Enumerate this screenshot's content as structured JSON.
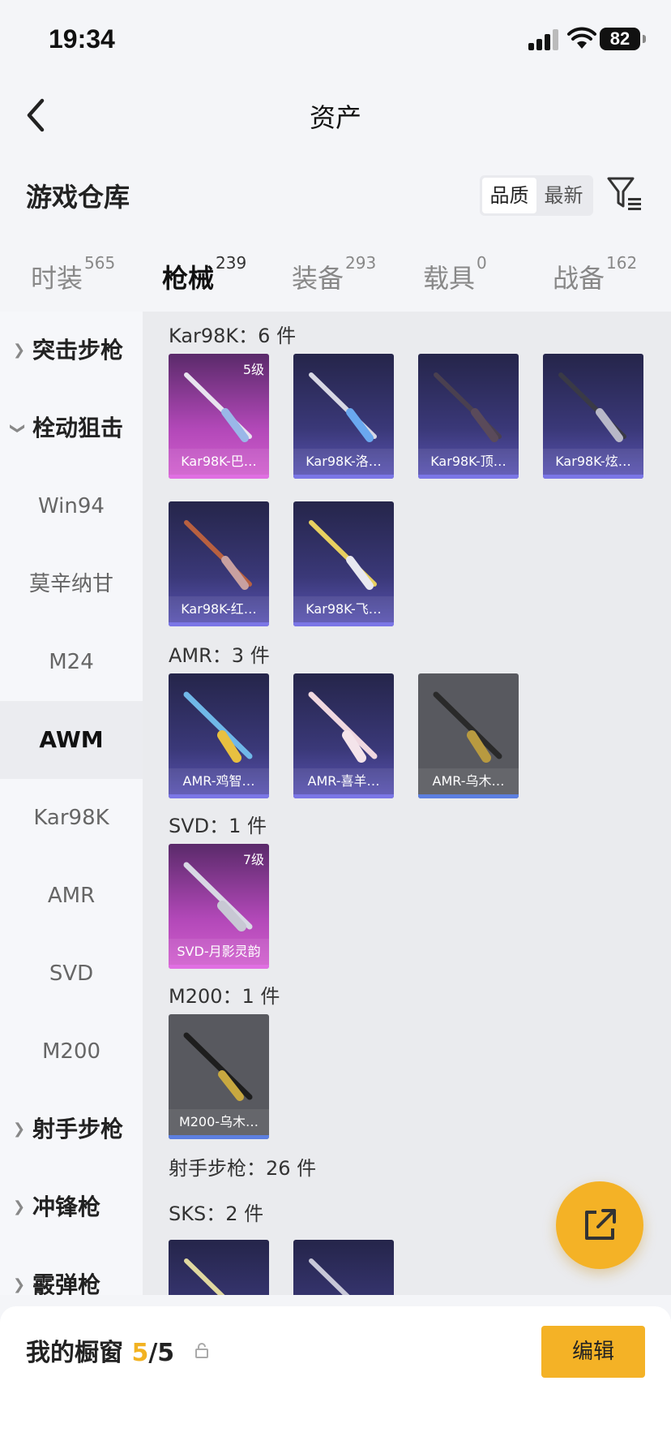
{
  "status": {
    "time": "19:34",
    "battery": "82"
  },
  "nav": {
    "title": "资产"
  },
  "header": {
    "title": "游戏仓库",
    "sort": [
      "品质",
      "最新"
    ]
  },
  "tabs": [
    {
      "label": "时装",
      "count": "565"
    },
    {
      "label": "枪械",
      "count": "239",
      "active": true
    },
    {
      "label": "装备",
      "count": "293"
    },
    {
      "label": "载具",
      "count": "0"
    },
    {
      "label": "战备",
      "count": "162"
    }
  ],
  "side": [
    {
      "label": "突击步枪",
      "type": "group",
      "expanded": false
    },
    {
      "label": "栓动狙击",
      "type": "group",
      "expanded": true
    },
    {
      "label": "Win94"
    },
    {
      "label": "莫辛纳甘"
    },
    {
      "label": "M24"
    },
    {
      "label": "AWM",
      "selected": true
    },
    {
      "label": "Kar98K"
    },
    {
      "label": "AMR"
    },
    {
      "label": "SVD"
    },
    {
      "label": "M200"
    },
    {
      "label": "射手步枪",
      "type": "group",
      "expanded": false
    },
    {
      "label": "冲锋枪",
      "type": "group",
      "expanded": false
    },
    {
      "label": "霰弹枪",
      "type": "group",
      "expanded": false
    }
  ],
  "sections": {
    "kar": {
      "label": "Kar98K：6 件",
      "items": [
        {
          "name": "Kar98K-巴…",
          "rarity": "pink",
          "level": "5级"
        },
        {
          "name": "Kar98K-洛…",
          "rarity": "purple"
        },
        {
          "name": "Kar98K-顶…",
          "rarity": "purple"
        },
        {
          "name": "Kar98K-炫…",
          "rarity": "purple"
        },
        {
          "name": "Kar98K-红…",
          "rarity": "purple"
        },
        {
          "name": "Kar98K-飞…",
          "rarity": "purple"
        }
      ]
    },
    "amr": {
      "label": "AMR：3 件",
      "items": [
        {
          "name": "AMR-鸡智…",
          "rarity": "purple"
        },
        {
          "name": "AMR-喜羊…",
          "rarity": "purple"
        },
        {
          "name": "AMR-乌木…",
          "rarity": "gray"
        }
      ]
    },
    "svd": {
      "label": "SVD：1 件",
      "items": [
        {
          "name": "SVD-月影灵韵",
          "rarity": "pink",
          "level": "7级"
        }
      ]
    },
    "m200": {
      "label": "M200：1 件",
      "items": [
        {
          "name": "M200-乌木…",
          "rarity": "gray"
        }
      ]
    },
    "marksman": {
      "label": "射手步枪：26 件"
    },
    "sks": {
      "label": "SKS：2 件",
      "items": [
        {
          "name": "",
          "rarity": "purple"
        },
        {
          "name": "",
          "rarity": "purple"
        }
      ]
    }
  },
  "bottom": {
    "label": "我的橱窗",
    "used": "5",
    "total": "/5",
    "edit_label": "编辑"
  },
  "colors": {
    "accent": "#f4b226",
    "purple": "#5b55b5",
    "pink": "#d360cf",
    "gray": "#58595f"
  },
  "icons": [
    "back-chevron-icon",
    "filter-icon",
    "lock-icon",
    "share-external-icon",
    "signal-icon",
    "wifi-icon",
    "battery-icon"
  ]
}
